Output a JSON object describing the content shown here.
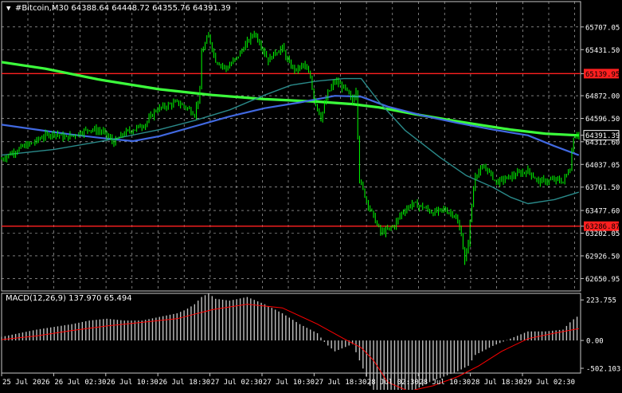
{
  "header": {
    "symbol_line": "#Bitcoin,M30  64388.64 64448.72 64355.76 64391.39"
  },
  "colors": {
    "background": "#000000",
    "grid": "#c8c8c8",
    "candle": "#00ff00",
    "ma_fast": "#4169e1",
    "ma_slow": "#3cff3c",
    "ma_mid": "#2a8a8a",
    "level_line": "#ff2020",
    "macd_hist": "#c0c0c0",
    "macd_signal": "#ff0000",
    "text": "#ffffff"
  },
  "chart_data": [
    {
      "type": "line",
      "title": "#Bitcoin,M30",
      "ylim": [
        62500,
        65860
      ],
      "y_ticks": [
        "65707.05",
        "65431.50",
        "65139.95",
        "64872.00",
        "64596.50",
        "64391.39",
        "64312.60",
        "64037.05",
        "63761.50",
        "63477.60",
        "63286.87",
        "63202.05",
        "62926.50",
        "62650.95"
      ],
      "x_tick_labels": [
        "25 Jul 2026",
        "26 Jul 02:30",
        "26 Jul 10:30",
        "26 Jul 18:30",
        "27 Jul 02:30",
        "27 Jul 10:30",
        "27 Jul 18:30",
        "28 Jul 02:30",
        "28 Jul 10:30",
        "28 Jul 18:30",
        "29 Jul 02:30"
      ],
      "last_price": 64391.39,
      "horizontal_levels": [
        65139.95,
        63286.87
      ],
      "price_path": [
        [
          0,
          64100
        ],
        [
          6,
          64180
        ],
        [
          12,
          64250
        ],
        [
          18,
          64300
        ],
        [
          24,
          64380
        ],
        [
          30,
          64420
        ],
        [
          36,
          64360
        ],
        [
          42,
          64400
        ],
        [
          50,
          64470
        ],
        [
          58,
          64430
        ],
        [
          64,
          64300
        ],
        [
          70,
          64420
        ],
        [
          76,
          64470
        ],
        [
          82,
          64530
        ],
        [
          88,
          64700
        ],
        [
          94,
          64750
        ],
        [
          100,
          64790
        ],
        [
          106,
          64720
        ],
        [
          110,
          64650
        ],
        [
          113,
          64920
        ],
        [
          114,
          65400
        ],
        [
          118,
          65600
        ],
        [
          122,
          65300
        ],
        [
          128,
          65200
        ],
        [
          134,
          65330
        ],
        [
          140,
          65520
        ],
        [
          144,
          65640
        ],
        [
          148,
          65480
        ],
        [
          152,
          65300
        ],
        [
          156,
          65400
        ],
        [
          160,
          65450
        ],
        [
          164,
          65250
        ],
        [
          168,
          65180
        ],
        [
          172,
          65250
        ],
        [
          176,
          65100
        ],
        [
          178,
          64850
        ],
        [
          182,
          64600
        ],
        [
          186,
          64900
        ],
        [
          190,
          65050
        ],
        [
          196,
          64950
        ],
        [
          200,
          64800
        ],
        [
          202,
          64950
        ],
        [
          204,
          63850
        ],
        [
          208,
          63600
        ],
        [
          212,
          63400
        ],
        [
          216,
          63210
        ],
        [
          220,
          63240
        ],
        [
          224,
          63300
        ],
        [
          228,
          63450
        ],
        [
          234,
          63560
        ],
        [
          240,
          63520
        ],
        [
          246,
          63450
        ],
        [
          252,
          63490
        ],
        [
          258,
          63430
        ],
        [
          262,
          63200
        ],
        [
          264,
          62850
        ],
        [
          266,
          63100
        ],
        [
          268,
          63550
        ],
        [
          270,
          63920
        ],
        [
          276,
          64000
        ],
        [
          282,
          63820
        ],
        [
          288,
          63870
        ],
        [
          294,
          63920
        ],
        [
          300,
          63960
        ],
        [
          306,
          63830
        ],
        [
          312,
          63840
        ],
        [
          316,
          63850
        ],
        [
          320,
          63830
        ],
        [
          324,
          64000
        ],
        [
          326,
          64380
        ],
        [
          329,
          64420
        ]
      ],
      "series": [
        {
          "points": [
            [
              0,
              65280
            ],
            [
              25,
              65200
            ],
            [
              55,
              65070
            ],
            [
              90,
              64950
            ],
            [
              120,
              64880
            ],
            [
              150,
              64830
            ],
            [
              180,
              64800
            ],
            [
              200,
              64770
            ],
            [
              215,
              64730
            ],
            [
              235,
              64650
            ],
            [
              260,
              64560
            ],
            [
              290,
              64460
            ],
            [
              310,
              64410
            ],
            [
              329,
              64390
            ]
          ]
        },
        {
          "points": [
            [
              0,
              64520
            ],
            [
              20,
              64460
            ],
            [
              40,
              64400
            ],
            [
              60,
              64350
            ],
            [
              75,
              64320
            ],
            [
              90,
              64380
            ],
            [
              110,
              64500
            ],
            [
              130,
              64620
            ],
            [
              150,
              64720
            ],
            [
              170,
              64790
            ],
            [
              190,
              64870
            ],
            [
              205,
              64860
            ],
            [
              220,
              64740
            ],
            [
              240,
              64630
            ],
            [
              260,
              64540
            ],
            [
              280,
              64460
            ],
            [
              300,
              64390
            ],
            [
              315,
              64260
            ],
            [
              329,
              64150
            ]
          ]
        },
        {
          "points": [
            [
              0,
              64150
            ],
            [
              30,
              64220
            ],
            [
              60,
              64330
            ],
            [
              90,
              64460
            ],
            [
              110,
              64570
            ],
            [
              130,
              64700
            ],
            [
              150,
              64880
            ],
            [
              165,
              65000
            ],
            [
              180,
              65050
            ],
            [
              195,
              65080
            ],
            [
              205,
              65080
            ],
            [
              215,
              64800
            ],
            [
              230,
              64450
            ],
            [
              250,
              64120
            ],
            [
              265,
              63900
            ],
            [
              280,
              63760
            ],
            [
              290,
              63640
            ],
            [
              300,
              63560
            ],
            [
              315,
              63610
            ],
            [
              329,
              63700
            ]
          ]
        }
      ]
    },
    {
      "type": "bar",
      "title": "MACD(12,26,9) 137.970 65.494",
      "ylim": [
        -180,
        260
      ],
      "y_ticks": [
        "223.755",
        "0.00",
        "-502.103"
      ],
      "hist": [
        [
          0,
          20
        ],
        [
          10,
          40
        ],
        [
          20,
          60
        ],
        [
          30,
          75
        ],
        [
          40,
          90
        ],
        [
          50,
          110
        ],
        [
          60,
          120
        ],
        [
          70,
          110
        ],
        [
          80,
          110
        ],
        [
          90,
          130
        ],
        [
          100,
          150
        ],
        [
          105,
          170
        ],
        [
          110,
          200
        ],
        [
          114,
          240
        ],
        [
          118,
          260
        ],
        [
          122,
          230
        ],
        [
          130,
          220
        ],
        [
          140,
          240
        ],
        [
          150,
          200
        ],
        [
          160,
          150
        ],
        [
          170,
          90
        ],
        [
          180,
          40
        ],
        [
          185,
          -20
        ],
        [
          190,
          -60
        ],
        [
          195,
          -40
        ],
        [
          200,
          -20
        ],
        [
          204,
          -110
        ],
        [
          208,
          -200
        ],
        [
          212,
          -300
        ],
        [
          216,
          -360
        ],
        [
          220,
          -380
        ],
        [
          228,
          -320
        ],
        [
          236,
          -270
        ],
        [
          244,
          -230
        ],
        [
          252,
          -200
        ],
        [
          260,
          -170
        ],
        [
          266,
          -140
        ],
        [
          270,
          -80
        ],
        [
          280,
          -30
        ],
        [
          290,
          10
        ],
        [
          300,
          50
        ],
        [
          310,
          50
        ],
        [
          320,
          60
        ],
        [
          325,
          110
        ],
        [
          329,
          138
        ]
      ],
      "signal": [
        [
          0,
          5
        ],
        [
          20,
          25
        ],
        [
          40,
          55
        ],
        [
          60,
          80
        ],
        [
          80,
          100
        ],
        [
          100,
          120
        ],
        [
          120,
          170
        ],
        [
          140,
          200
        ],
        [
          160,
          180
        ],
        [
          180,
          90
        ],
        [
          195,
          10
        ],
        [
          205,
          -40
        ],
        [
          212,
          -110
        ],
        [
          220,
          -230
        ],
        [
          232,
          -280
        ],
        [
          246,
          -250
        ],
        [
          260,
          -200
        ],
        [
          272,
          -140
        ],
        [
          285,
          -60
        ],
        [
          300,
          10
        ],
        [
          315,
          40
        ],
        [
          329,
          65
        ]
      ]
    }
  ]
}
